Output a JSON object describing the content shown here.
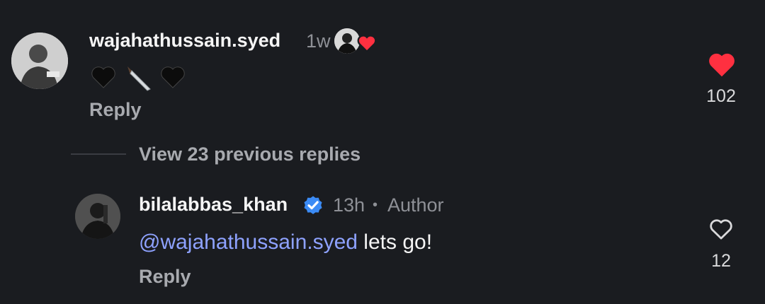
{
  "comment": {
    "username": "wajahathussain.syed",
    "time": "1w",
    "emoji_text": "🖤🔪🖤",
    "reply_label": "Reply",
    "like_count": "102",
    "liked": true,
    "like_color": "#ff3040"
  },
  "thread": {
    "view_previous": "View 23 previous replies"
  },
  "reply": {
    "username": "bilalabbas_khan",
    "verified_color": "#3b8bf5",
    "time": "13h",
    "separator": "•",
    "author_label": "Author",
    "mention": "@wajahathussain.syed",
    "text": " lets go!",
    "reply_label": "Reply",
    "like_count": "12",
    "liked": false
  }
}
